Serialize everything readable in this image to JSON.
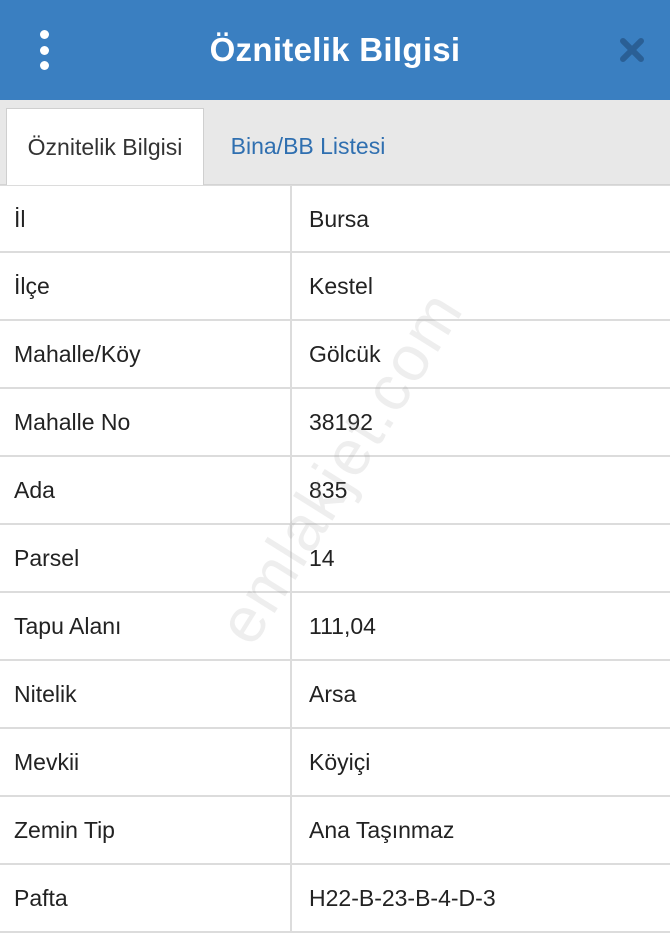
{
  "header": {
    "title": "Öznitelik Bilgisi",
    "menu_icon": "more-vertical-icon",
    "close_icon": "close-icon",
    "color": "#3a7fc1"
  },
  "tabs": [
    {
      "label": "Öznitelik Bilgisi",
      "active": true
    },
    {
      "label": "Bina/BB Listesi",
      "active": false
    }
  ],
  "table": {
    "rows": [
      {
        "label": "İl",
        "value": "Bursa"
      },
      {
        "label": "İlçe",
        "value": "Kestel"
      },
      {
        "label": "Mahalle/Köy",
        "value": "Gölcük"
      },
      {
        "label": "Mahalle No",
        "value": "38192"
      },
      {
        "label": "Ada",
        "value": "835"
      },
      {
        "label": "Parsel",
        "value": "14"
      },
      {
        "label": "Tapu Alanı",
        "value": "111,04"
      },
      {
        "label": "Nitelik",
        "value": "Arsa"
      },
      {
        "label": "Mevkii",
        "value": "Köyiçi"
      },
      {
        "label": "Zemin Tip",
        "value": "Ana Taşınmaz"
      },
      {
        "label": "Pafta",
        "value": "H22-B-23-B-4-D-3"
      }
    ]
  },
  "watermark": "emlakjet.com"
}
